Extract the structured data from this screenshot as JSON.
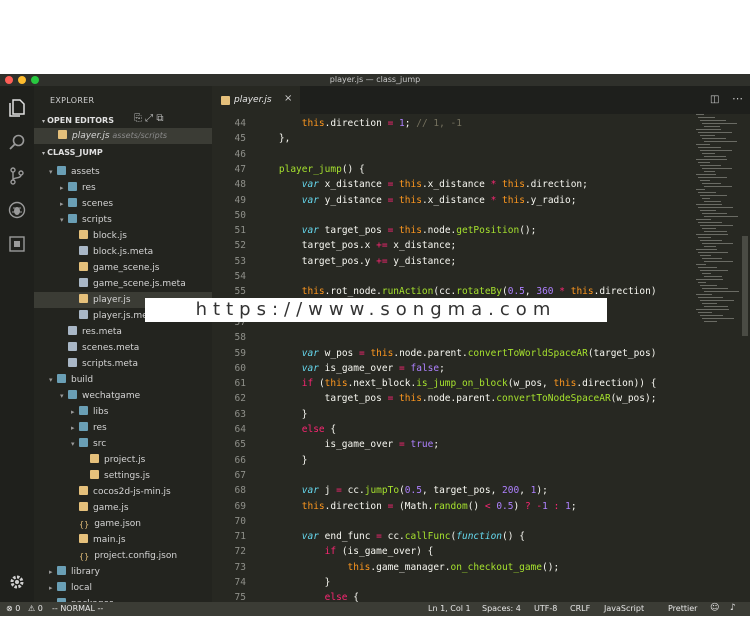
{
  "window": {
    "title": "player.js — class_jump",
    "traffic_colors": [
      "#ff5f57",
      "#febc2e",
      "#28c840"
    ]
  },
  "activity_bar": {
    "icons": [
      "files-icon",
      "search-icon",
      "source-control-icon",
      "debug-icon",
      "extensions-icon",
      "gear-icon"
    ]
  },
  "sidebar": {
    "title": "EXPLORER",
    "open_editors": {
      "label": "OPEN EDITORS",
      "file": "player.js",
      "path": "assets/scripts"
    },
    "project": {
      "label": "CLASS_JUMP",
      "tree": [
        {
          "label": "assets",
          "kind": "folder",
          "depth": 1,
          "open": true
        },
        {
          "label": "res",
          "kind": "folder",
          "depth": 2,
          "open": false
        },
        {
          "label": "scenes",
          "kind": "folder",
          "depth": 2,
          "open": false
        },
        {
          "label": "scripts",
          "kind": "folder",
          "depth": 2,
          "open": true
        },
        {
          "label": "block.js",
          "kind": "js",
          "depth": 3
        },
        {
          "label": "block.js.meta",
          "kind": "meta",
          "depth": 3
        },
        {
          "label": "game_scene.js",
          "kind": "js",
          "depth": 3
        },
        {
          "label": "game_scene.js.meta",
          "kind": "meta",
          "depth": 3
        },
        {
          "label": "player.js",
          "kind": "js",
          "depth": 3,
          "selected": true
        },
        {
          "label": "player.js.meta",
          "kind": "meta",
          "depth": 3
        },
        {
          "label": "res.meta",
          "kind": "meta",
          "depth": 2
        },
        {
          "label": "scenes.meta",
          "kind": "meta",
          "depth": 2
        },
        {
          "label": "scripts.meta",
          "kind": "meta",
          "depth": 2
        },
        {
          "label": "build",
          "kind": "folder",
          "depth": 1,
          "open": true
        },
        {
          "label": "wechatgame",
          "kind": "folder",
          "depth": 2,
          "open": true
        },
        {
          "label": "libs",
          "kind": "folder",
          "depth": 3,
          "open": false
        },
        {
          "label": "res",
          "kind": "folder",
          "depth": 3,
          "open": false
        },
        {
          "label": "src",
          "kind": "folder",
          "depth": 3,
          "open": true
        },
        {
          "label": "project.js",
          "kind": "js",
          "depth": 4
        },
        {
          "label": "settings.js",
          "kind": "js",
          "depth": 4
        },
        {
          "label": "cocos2d-js-min.js",
          "kind": "js",
          "depth": 3
        },
        {
          "label": "game.js",
          "kind": "js",
          "depth": 3
        },
        {
          "label": "game.json",
          "kind": "json",
          "depth": 3
        },
        {
          "label": "main.js",
          "kind": "js",
          "depth": 3
        },
        {
          "label": "project.config.json",
          "kind": "json",
          "depth": 3
        },
        {
          "label": "library",
          "kind": "folder",
          "depth": 1,
          "open": false
        },
        {
          "label": "local",
          "kind": "folder",
          "depth": 1,
          "open": false
        },
        {
          "label": "packages",
          "kind": "folder",
          "depth": 1,
          "open": false
        }
      ]
    }
  },
  "editor": {
    "tab": {
      "label": "player.js",
      "close": "×"
    },
    "lines": [
      {
        "n": "44",
        "html": "        <span class='th'>this</span>.direction <span class='kw'>=</span> <span class='nm'>1</span>; <span class='cm'>// 1, -1</span>"
      },
      {
        "n": "45",
        "html": "    },"
      },
      {
        "n": "46",
        "html": ""
      },
      {
        "n": "47",
        "html": "    <span class='fn'>player_jump</span>() {"
      },
      {
        "n": "48",
        "html": "        <span class='st'>var</span> x_distance <span class='kw'>=</span> <span class='th'>this</span>.x_distance <span class='kw'>*</span> <span class='th'>this</span>.direction;"
      },
      {
        "n": "49",
        "html": "        <span class='st'>var</span> y_distance <span class='kw'>=</span> <span class='th'>this</span>.x_distance <span class='kw'>*</span> <span class='th'>this</span>.y_radio;"
      },
      {
        "n": "50",
        "html": ""
      },
      {
        "n": "51",
        "html": "        <span class='st'>var</span> target_pos <span class='kw'>=</span> <span class='th'>this</span>.node.<span class='fn'>getPosition</span>();"
      },
      {
        "n": "52",
        "html": "        target_pos.x <span class='kw'>+=</span> x_distance;"
      },
      {
        "n": "53",
        "html": "        target_pos.y <span class='kw'>+=</span> y_distance;"
      },
      {
        "n": "54",
        "html": ""
      },
      {
        "n": "55",
        "html": "        <span class='th'>this</span>.rot_node.<span class='fn'>runAction</span>(cc.<span class='fn'>rotateBy</span>(<span class='nm'>0.5</span>, <span class='nm'>360</span> <span class='kw'>*</span> <span class='th'>this</span>.direction)"
      },
      {
        "n": "56",
        "html": ""
      },
      {
        "n": "57",
        "html": ""
      },
      {
        "n": "58",
        "html": ""
      },
      {
        "n": "59",
        "html": "        <span class='st'>var</span> w_pos <span class='kw'>=</span> <span class='th'>this</span>.node.parent.<span class='fn'>convertToWorldSpaceAR</span>(target_pos)"
      },
      {
        "n": "60",
        "html": "        <span class='st'>var</span> is_game_over <span class='kw'>=</span> <span class='nm'>false</span>;"
      },
      {
        "n": "61",
        "html": "        <span class='kw'>if</span> (<span class='th'>this</span>.next_block.<span class='fn'>is_jump_on_block</span>(w_pos, <span class='th'>this</span>.direction)) {"
      },
      {
        "n": "62",
        "html": "            target_pos <span class='kw'>=</span> <span class='th'>this</span>.node.parent.<span class='fn'>convertToNodeSpaceAR</span>(w_pos);"
      },
      {
        "n": "63",
        "html": "        }"
      },
      {
        "n": "64",
        "html": "        <span class='kw'>else</span> {"
      },
      {
        "n": "65",
        "html": "            is_game_over <span class='kw'>=</span> <span class='nm'>true</span>;"
      },
      {
        "n": "66",
        "html": "        }"
      },
      {
        "n": "67",
        "html": ""
      },
      {
        "n": "68",
        "html": "        <span class='st'>var</span> j <span class='kw'>=</span> cc.<span class='fn'>jumpTo</span>(<span class='nm'>0.5</span>, target_pos, <span class='nm'>200</span>, <span class='nm'>1</span>);"
      },
      {
        "n": "69",
        "html": "        <span class='th'>this</span>.direction <span class='kw'>=</span> (Math.<span class='fn'>random</span>() <span class='kw'>&lt;</span> <span class='nm'>0.5</span>) <span class='kw'>?</span> <span class='kw'>-</span><span class='nm'>1</span> <span class='kw'>:</span> <span class='nm'>1</span>;"
      },
      {
        "n": "70",
        "html": ""
      },
      {
        "n": "71",
        "html": "        <span class='st'>var</span> end_func <span class='kw'>=</span> cc.<span class='fn'>callFunc</span>(<span class='st'>function</span>() {"
      },
      {
        "n": "72",
        "html": "            <span class='kw'>if</span> (is_game_over) {"
      },
      {
        "n": "73",
        "html": "                <span class='th'>this</span>.game_manager.<span class='fn'>on_checkout_game</span>();"
      },
      {
        "n": "74",
        "html": "            }"
      },
      {
        "n": "75",
        "html": "            <span class='kw'>else</span> {"
      }
    ]
  },
  "watermark": "https://www.songma.com",
  "status": {
    "errors": "⊗ 0",
    "warnings": "⚠ 0",
    "mode": "-- NORMAL --",
    "position": "Ln 1, Col 1",
    "spaces": "Spaces: 4",
    "encoding": "UTF-8",
    "eol": "CRLF",
    "language": "JavaScript",
    "formatter": "Prettier"
  }
}
